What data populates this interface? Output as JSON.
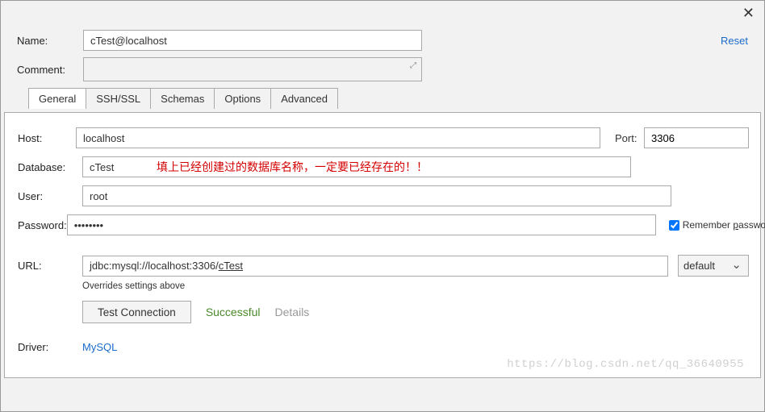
{
  "top": {
    "name_label": "Name:",
    "name_value": "cTest@localhost",
    "comment_label": "Comment:",
    "reset": "Reset"
  },
  "tabs": {
    "general": "General",
    "sshssl": "SSH/SSL",
    "schemas": "Schemas",
    "options": "Options",
    "advanced": "Advanced"
  },
  "form": {
    "host_label": "Host:",
    "host_value": "localhost",
    "port_label": "Port:",
    "port_value": "3306",
    "database_label": "Database:",
    "database_value": "cTest",
    "user_label": "User:",
    "user_value": "root",
    "password_label": "Password:",
    "password_value": "••••••••",
    "remember_label": "Remember password",
    "url_label": "URL:",
    "url_prefix": "jdbc:mysql://localhost:3306/",
    "url_db": "cTest",
    "url_scheme": "default",
    "overrides": "Overrides settings above",
    "test_btn": "Test Connection",
    "successful": "Successful",
    "details": "Details",
    "driver_label": "Driver:",
    "driver_link": "MySQL"
  },
  "annotation": "填上已经创建过的数据库名称，一定要已经存在的！！",
  "watermark": "https://blog.csdn.net/qq_36640955"
}
